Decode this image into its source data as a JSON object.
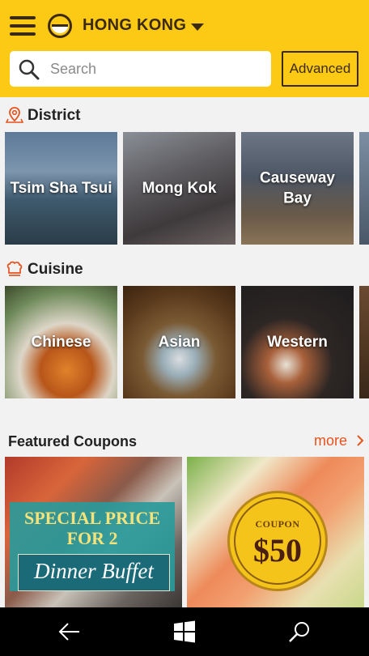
{
  "header": {
    "city": "HONG KONG",
    "search_placeholder": "Search",
    "advanced_label": "Advanced"
  },
  "district": {
    "title": "District",
    "items": [
      {
        "label": "Tsim Sha Tsui"
      },
      {
        "label": "Mong Kok"
      },
      {
        "label": "Causeway Bay"
      }
    ]
  },
  "cuisine": {
    "title": "Cuisine",
    "items": [
      {
        "label": "Chinese"
      },
      {
        "label": "Asian"
      },
      {
        "label": "Western"
      }
    ]
  },
  "featured": {
    "title": "Featured Coupons",
    "more_label": "more",
    "coupons": [
      {
        "line1": "SPECIAL PRICE",
        "line2": "FOR 2",
        "banner": "Dinner Buffet"
      },
      {
        "badge_label": "COUPON",
        "amount": "$50"
      }
    ]
  },
  "colors": {
    "header_bg": "#fcc915",
    "accent": "#e5531e",
    "nav_bg": "#000000"
  },
  "icons": {
    "menu": "hamburger-icon",
    "logo": "bowl-logo-icon",
    "caret": "caret-down-icon",
    "search": "search-icon",
    "district": "map-pin-icon",
    "cuisine": "chef-hat-icon",
    "more": "chevron-right-icon",
    "back": "back-arrow-icon",
    "home": "windows-logo-icon",
    "nav_search": "search-icon"
  }
}
